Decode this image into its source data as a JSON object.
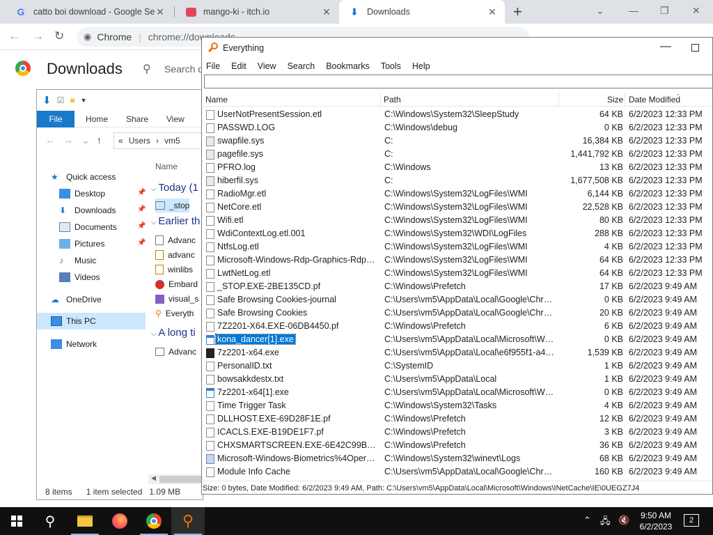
{
  "chrome": {
    "tabs": [
      {
        "title": "catto boi download - Google Sea",
        "icon": "google-icon"
      },
      {
        "title": "mango-ki - itch.io",
        "icon": "itch-icon"
      },
      {
        "title": "Downloads",
        "icon": "download-icon"
      }
    ],
    "omnibox": {
      "site": "Chrome",
      "url": "chrome://downloads"
    },
    "page_title": "Downloads",
    "search_placeholder": "Search d"
  },
  "explorer": {
    "ribbon": {
      "file": "File",
      "home": "Home",
      "share": "Share",
      "view": "View"
    },
    "address": {
      "prefix": "«",
      "parts": [
        "Users",
        "vm5"
      ]
    },
    "nav": {
      "quick_access": "Quick access",
      "desktop": "Desktop",
      "downloads": "Downloads",
      "documents": "Documents",
      "pictures": "Pictures",
      "music": "Music",
      "videos": "Videos",
      "onedrive": "OneDrive",
      "this_pc": "This PC",
      "network": "Network"
    },
    "content": {
      "name_header": "Name",
      "group_today": "Today (1",
      "group_earlier": "Earlier th",
      "group_long": "A long ti",
      "items": [
        "_stop",
        "Advanc",
        "advanc",
        "winlibs",
        "Embard",
        "visual_s",
        "Everyth",
        "Advanc"
      ]
    },
    "status": {
      "count": "8 items",
      "selected": "1 item selected",
      "size": "1.09 MB"
    }
  },
  "everything": {
    "title": "Everything",
    "menu": [
      "File",
      "Edit",
      "View",
      "Search",
      "Bookmarks",
      "Tools",
      "Help"
    ],
    "columns": {
      "name": "Name",
      "path": "Path",
      "size": "Size",
      "date": "Date Modified"
    },
    "rows": [
      {
        "name": "UserNotPresentSession.etl",
        "path": "C:\\Windows\\System32\\SleepStudy",
        "size": "64 KB",
        "date": "6/2/2023 12:33 PM",
        "icon": "file"
      },
      {
        "name": "PASSWD.LOG",
        "path": "C:\\Windows\\debug",
        "size": "0 KB",
        "date": "6/2/2023 12:33 PM",
        "icon": "file"
      },
      {
        "name": "swapfile.sys",
        "path": "C:",
        "size": "16,384 KB",
        "date": "6/2/2023 12:33 PM",
        "icon": "sys"
      },
      {
        "name": "pagefile.sys",
        "path": "C:",
        "size": "1,441,792 KB",
        "date": "6/2/2023 12:33 PM",
        "icon": "sys"
      },
      {
        "name": "PFRO.log",
        "path": "C:\\Windows",
        "size": "13 KB",
        "date": "6/2/2023 12:33 PM",
        "icon": "file"
      },
      {
        "name": "hiberfil.sys",
        "path": "C:",
        "size": "1,677,508 KB",
        "date": "6/2/2023 12:33 PM",
        "icon": "sys"
      },
      {
        "name": "RadioMgr.etl",
        "path": "C:\\Windows\\System32\\LogFiles\\WMI",
        "size": "6,144 KB",
        "date": "6/2/2023 12:33 PM",
        "icon": "file"
      },
      {
        "name": "NetCore.etl",
        "path": "C:\\Windows\\System32\\LogFiles\\WMI",
        "size": "22,528 KB",
        "date": "6/2/2023 12:33 PM",
        "icon": "file"
      },
      {
        "name": "Wifi.etl",
        "path": "C:\\Windows\\System32\\LogFiles\\WMI",
        "size": "80 KB",
        "date": "6/2/2023 12:33 PM",
        "icon": "file"
      },
      {
        "name": "WdiContextLog.etl.001",
        "path": "C:\\Windows\\System32\\WDI\\LogFiles",
        "size": "288 KB",
        "date": "6/2/2023 12:33 PM",
        "icon": "file"
      },
      {
        "name": "NtfsLog.etl",
        "path": "C:\\Windows\\System32\\LogFiles\\WMI",
        "size": "4 KB",
        "date": "6/2/2023 12:33 PM",
        "icon": "file"
      },
      {
        "name": "Microsoft-Windows-Rdp-Graphics-RdpId...",
        "path": "C:\\Windows\\System32\\LogFiles\\WMI",
        "size": "64 KB",
        "date": "6/2/2023 12:33 PM",
        "icon": "file"
      },
      {
        "name": "LwtNetLog.etl",
        "path": "C:\\Windows\\System32\\LogFiles\\WMI",
        "size": "64 KB",
        "date": "6/2/2023 12:33 PM",
        "icon": "file"
      },
      {
        "name": "_STOP.EXE-2BE135CD.pf",
        "path": "C:\\Windows\\Prefetch",
        "size": "17 KB",
        "date": "6/2/2023 9:49 AM",
        "icon": "file"
      },
      {
        "name": "Safe Browsing Cookies-journal",
        "path": "C:\\Users\\vm5\\AppData\\Local\\Google\\Chro...",
        "size": "0 KB",
        "date": "6/2/2023 9:49 AM",
        "icon": "file"
      },
      {
        "name": "Safe Browsing Cookies",
        "path": "C:\\Users\\vm5\\AppData\\Local\\Google\\Chro...",
        "size": "20 KB",
        "date": "6/2/2023 9:49 AM",
        "icon": "file"
      },
      {
        "name": "7Z2201-X64.EXE-06DB4450.pf",
        "path": "C:\\Windows\\Prefetch",
        "size": "6 KB",
        "date": "6/2/2023 9:49 AM",
        "icon": "file"
      },
      {
        "name": "kona_dancer[1].exe",
        "path": "C:\\Users\\vm5\\AppData\\Local\\Microsoft\\Win...",
        "size": "0 KB",
        "date": "6/2/2023 9:49 AM",
        "icon": "exe",
        "selected": true
      },
      {
        "name": "7z2201-x64.exe",
        "path": "C:\\Users\\vm5\\AppData\\Local\\e6f955f1-a407-...",
        "size": "1,539 KB",
        "date": "6/2/2023 9:49 AM",
        "icon": "zip"
      },
      {
        "name": "PersonalID.txt",
        "path": "C:\\SystemID",
        "size": "1 KB",
        "date": "6/2/2023 9:49 AM",
        "icon": "file"
      },
      {
        "name": "bowsakkdestx.txt",
        "path": "C:\\Users\\vm5\\AppData\\Local",
        "size": "1 KB",
        "date": "6/2/2023 9:49 AM",
        "icon": "file"
      },
      {
        "name": "7z2201-x64[1].exe",
        "path": "C:\\Users\\vm5\\AppData\\Local\\Microsoft\\Win...",
        "size": "0 KB",
        "date": "6/2/2023 9:49 AM",
        "icon": "exe"
      },
      {
        "name": "Time Trigger Task",
        "path": "C:\\Windows\\System32\\Tasks",
        "size": "4 KB",
        "date": "6/2/2023 9:49 AM",
        "icon": "file"
      },
      {
        "name": "DLLHOST.EXE-69D28F1E.pf",
        "path": "C:\\Windows\\Prefetch",
        "size": "12 KB",
        "date": "6/2/2023 9:49 AM",
        "icon": "file"
      },
      {
        "name": "ICACLS.EXE-B19DE1F7.pf",
        "path": "C:\\Windows\\Prefetch",
        "size": "3 KB",
        "date": "6/2/2023 9:49 AM",
        "icon": "file"
      },
      {
        "name": "CHXSMARTSCREEN.EXE-6E42C99B.pf",
        "path": "C:\\Windows\\Prefetch",
        "size": "36 KB",
        "date": "6/2/2023 9:49 AM",
        "icon": "file"
      },
      {
        "name": "Microsoft-Windows-Biometrics%4Operati...",
        "path": "C:\\Windows\\System32\\winevt\\Logs",
        "size": "68 KB",
        "date": "6/2/2023 9:49 AM",
        "icon": "dll"
      },
      {
        "name": "Module Info Cache",
        "path": "C:\\Users\\vm5\\AppData\\Local\\Google\\Chro...",
        "size": "160 KB",
        "date": "6/2/2023 9:49 AM",
        "icon": "file"
      }
    ],
    "status": "Size: 0 bytes, Date Modified: 6/2/2023 9:49 AM, Path: C:\\Users\\vm5\\AppData\\Local\\Microsoft\\Windows\\INetCache\\IE\\0UEGZ7J4"
  },
  "taskbar": {
    "time": "9:50 AM",
    "date": "6/2/2023",
    "notifications": "2"
  }
}
